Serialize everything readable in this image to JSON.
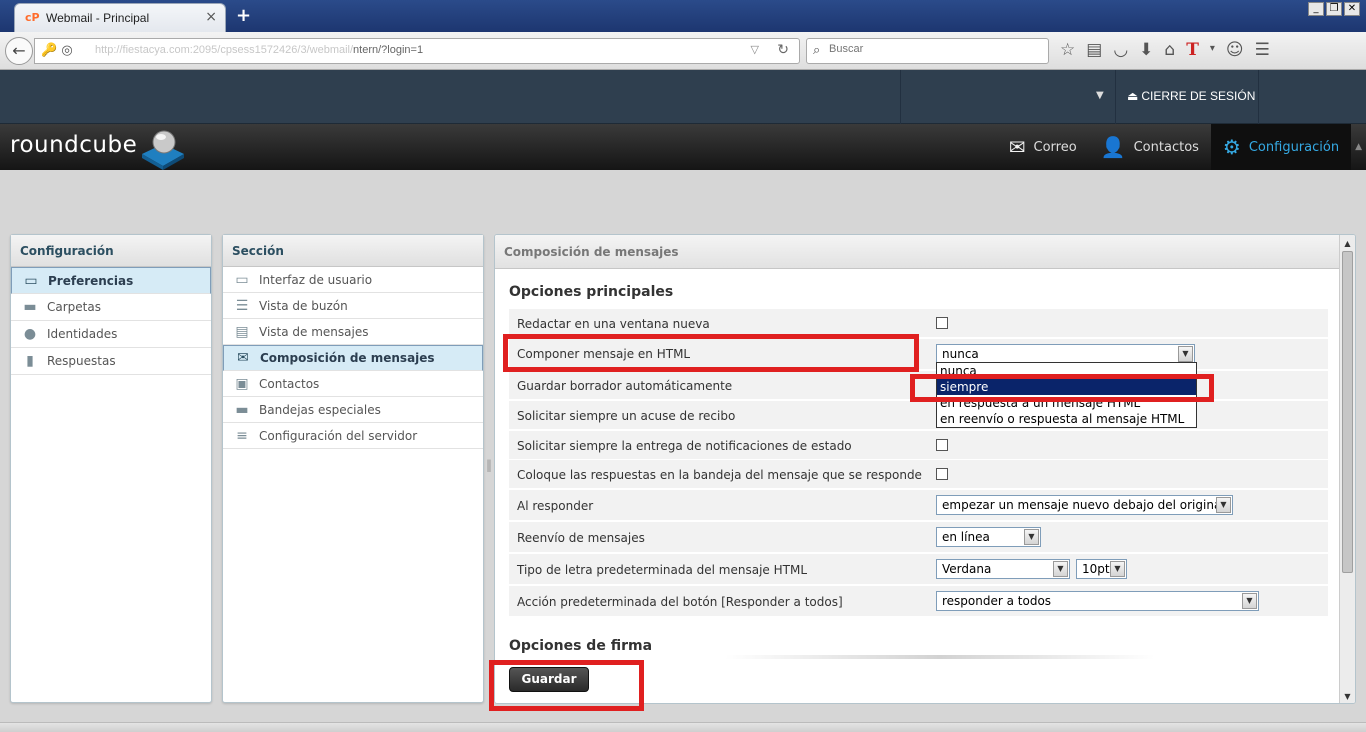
{
  "browser": {
    "tab_title": "Webmail - Principal",
    "favicon": "cP",
    "close_glyph": "×",
    "newtab_glyph": "+",
    "url_hidden": "http://fiestacya.com:2095/cpsess1572426/3/webmail/",
    "url_visible": "ntern/?login=1",
    "search_placeholder": "Buscar",
    "window_buttons": [
      "_",
      "❐",
      "✕"
    ],
    "toolbar_icons": [
      "star-icon",
      "reading-list-icon",
      "pocket-icon",
      "download-icon",
      "home-icon",
      "t-icon",
      "menu-caret-icon",
      "smiley-icon",
      "hamburger-icon"
    ]
  },
  "topbar": {
    "logout_label": "CIERRE DE SESIÓN"
  },
  "header": {
    "logo_text": "roundcube",
    "nav": [
      {
        "label": "Correo",
        "icon": "mail-icon"
      },
      {
        "label": "Contactos",
        "icon": "user-icon"
      },
      {
        "label": "Configuración",
        "icon": "gear-icon",
        "active": true
      }
    ]
  },
  "settings_panel": {
    "title": "Configuración",
    "items": [
      {
        "label": "Preferencias",
        "icon": "monitor-icon",
        "selected": true
      },
      {
        "label": "Carpetas",
        "icon": "folder-icon"
      },
      {
        "label": "Identidades",
        "icon": "person-icon"
      },
      {
        "label": "Respuestas",
        "icon": "document-icon"
      }
    ]
  },
  "section_panel": {
    "title": "Sección",
    "items": [
      {
        "label": "Interfaz de usuario",
        "icon": "monitor-icon"
      },
      {
        "label": "Vista de buzón",
        "icon": "list-icon"
      },
      {
        "label": "Vista de mensajes",
        "icon": "message-view-icon"
      },
      {
        "label": "Composición de mensajes",
        "icon": "compose-icon",
        "selected": true
      },
      {
        "label": "Contactos",
        "icon": "contacts-icon"
      },
      {
        "label": "Bandejas especiales",
        "icon": "folder-icon"
      },
      {
        "label": "Configuración del servidor",
        "icon": "server-icon"
      }
    ]
  },
  "content": {
    "title": "Composición de mensajes",
    "main_options_legend": "Opciones principales",
    "rows": [
      {
        "label": "Redactar en una ventana nueva",
        "type": "checkbox"
      },
      {
        "label": "Componer mensaje en HTML",
        "type": "select",
        "value": "nunca"
      },
      {
        "label": "Guardar borrador automáticamente",
        "type": "select",
        "value": ""
      },
      {
        "label": "Solicitar siempre un acuse de recibo",
        "type": "checkbox"
      },
      {
        "label": "Solicitar siempre la entrega de notificaciones de estado",
        "type": "checkbox"
      },
      {
        "label": "Coloque las respuestas en la bandeja del mensaje que se responde",
        "type": "checkbox"
      },
      {
        "label": "Al responder",
        "type": "select",
        "value": "empezar un mensaje nuevo debajo del original"
      },
      {
        "label": "Reenvío de mensajes",
        "type": "select",
        "value": "en línea"
      },
      {
        "label": "Tipo de letra predeterminada del mensaje HTML",
        "type": "select",
        "value": "Verdana",
        "value2": "10pt"
      },
      {
        "label": "Acción predeterminada del botón [Responder a todos]",
        "type": "select",
        "value": "responder a todos"
      }
    ],
    "dropdown_options": [
      "nunca",
      "siempre",
      "en respuesta a un mensaje HTML",
      "en reenvío o respuesta al mensaje HTML"
    ],
    "dropdown_highlighted": "siempre",
    "signature_legend": "Opciones de firma",
    "save_label": "Guardar"
  },
  "colors": {
    "accent": "#35a9e3",
    "highlight_box": "#e02020",
    "selected_option": "#0a246a"
  }
}
